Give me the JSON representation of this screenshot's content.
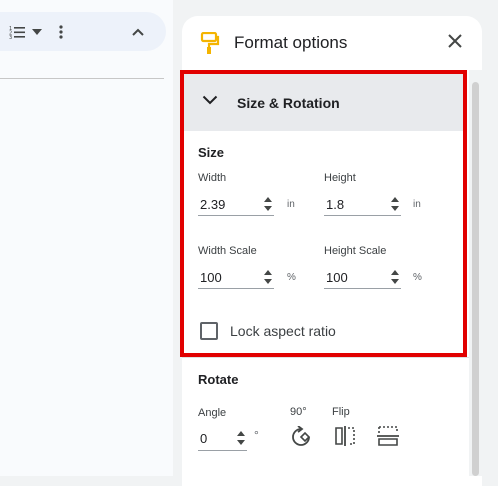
{
  "toolbar": {
    "list_icon": "numbered-list-icon",
    "dropdown_icon": "caret-down-icon",
    "more_icon": "more-vert-icon",
    "collapse_icon": "chevron-up-icon"
  },
  "panel": {
    "title": "Format options",
    "title_icon": "paint-roller-icon",
    "close_icon": "close-icon"
  },
  "size_rotation": {
    "section_title": "Size & Rotation",
    "size_heading": "Size",
    "width": {
      "label": "Width",
      "value": "2.39",
      "unit": "in"
    },
    "height": {
      "label": "Height",
      "value": "1.8",
      "unit": "in"
    },
    "width_scale": {
      "label": "Width Scale",
      "value": "100",
      "unit": "%"
    },
    "height_scale": {
      "label": "Height Scale",
      "value": "100",
      "unit": "%"
    },
    "lock_aspect": {
      "label": "Lock aspect ratio",
      "checked": false
    }
  },
  "rotate": {
    "heading": "Rotate",
    "angle": {
      "label": "Angle",
      "value": "0",
      "unit": "°"
    },
    "rotate90_label": "90°",
    "flip_label": "Flip"
  },
  "colors": {
    "highlight": "#e10000",
    "section_header_bg": "#e8eaed",
    "toolbar_bg": "#edf2fa",
    "paint_icon": "#f4b400"
  }
}
